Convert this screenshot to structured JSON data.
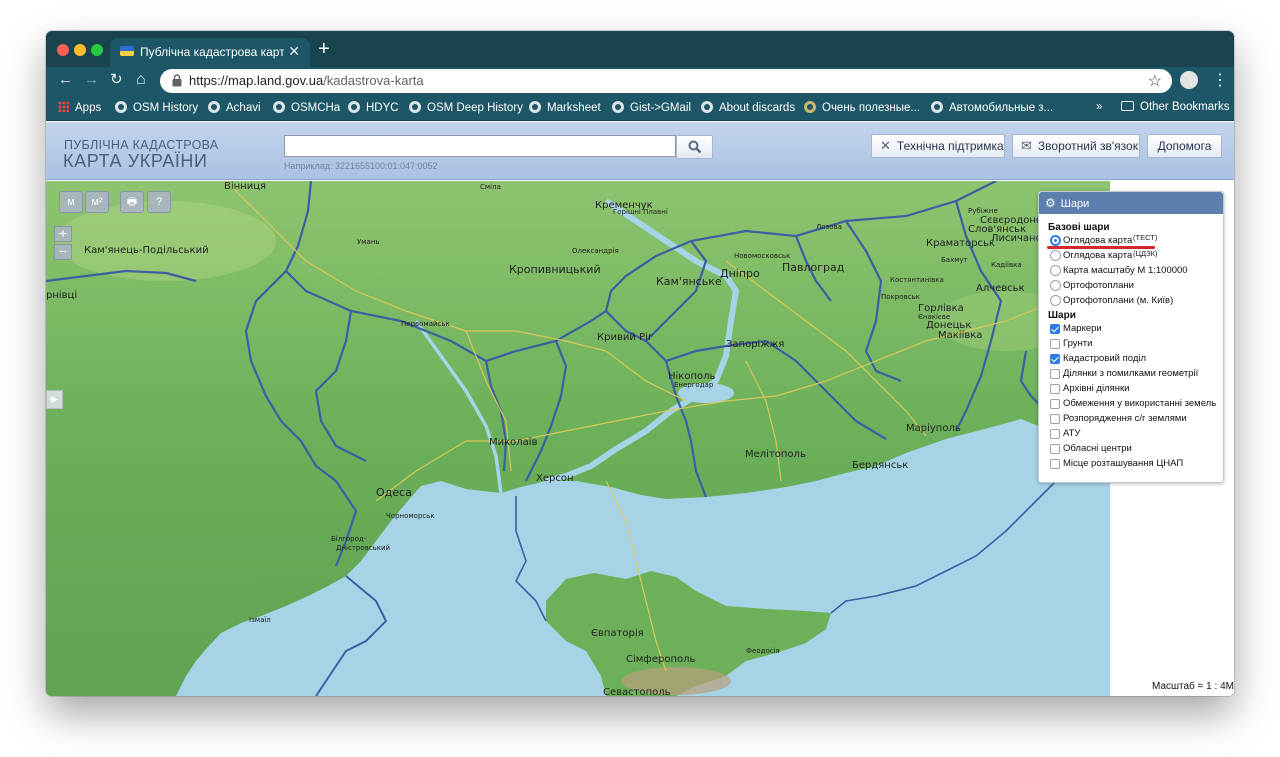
{
  "browser": {
    "tab_title": "Публічна кадастрова карта Ук",
    "tab_close": "✕",
    "new_tab": "+",
    "url_host": "https://map.land.gov.ua",
    "url_path": "/kadastrova-karta",
    "back_icon": "←",
    "forward_icon": "→",
    "reload_icon": "↻",
    "home_icon": "⌂",
    "star_icon": "☆",
    "menu_icon": "⋮"
  },
  "bookmarks": {
    "items": [
      {
        "label": "Apps"
      },
      {
        "label": "OSM History"
      },
      {
        "label": "Achavi"
      },
      {
        "label": "OSMCHa"
      },
      {
        "label": "HDYC"
      },
      {
        "label": "OSM Deep History"
      },
      {
        "label": "Marksheet"
      },
      {
        "label": "Gist->GMail"
      },
      {
        "label": "About discards"
      },
      {
        "label": "Очень полезные..."
      },
      {
        "label": "Автомобильные з..."
      }
    ],
    "overflow": "»",
    "other": "Other Bookmarks"
  },
  "header": {
    "logo_small": "ПУБЛІЧНА КАДАСТРОВА",
    "logo_big": "КАРТА УКРАЇНИ",
    "search_value": "",
    "search_hint": "Наприклад: 3221655100:01:047:0052",
    "support_button": "Технічна підтримка",
    "feedback_button": "Зворотний зв'язок",
    "help_button": "Допомога"
  },
  "map_controls": {
    "measure_length": "м",
    "measure_area": "м²",
    "print_icon": "🖶",
    "identify_icon": "?",
    "zoom_in": "+",
    "zoom_out": "−",
    "side_toggle": "▶"
  },
  "layers_panel": {
    "title": "Шари",
    "base_section": "Базові шари",
    "base_layers": [
      {
        "label": "Оглядова карта",
        "selected": true
      },
      {
        "label": "Оглядова карта",
        "selected": false
      },
      {
        "label": "Карта масштабу М 1:100000",
        "selected": false
      },
      {
        "label": "Ортофотоплани",
        "selected": false
      },
      {
        "label": "Ортофотоплани (м. Київ)",
        "selected": false
      }
    ],
    "sup_test": "(ТЕСТ)",
    "sup_dzk": "(ЦДЗК)",
    "layers_section": "Шари",
    "layers": [
      {
        "label": "Маркери",
        "checked": true
      },
      {
        "label": "Грунти",
        "checked": false
      },
      {
        "label": "Кадастровий поділ",
        "checked": true
      },
      {
        "label": "Ділянки з помилками геометрії",
        "checked": false
      },
      {
        "label": "Архівні ділянки",
        "checked": false
      },
      {
        "label": "Обмеження у використанні земель",
        "checked": false
      },
      {
        "label": "Розпорядження с/г землями",
        "checked": false
      },
      {
        "label": "АТУ",
        "checked": false
      },
      {
        "label": "Обласні центри",
        "checked": false
      },
      {
        "label": "Місце розташування ЦНАП",
        "checked": false
      }
    ]
  },
  "scale": "Масштаб = 1 : 4M",
  "map_labels": {
    "vinnytsia": "Вінниця",
    "kamianets": "Кам'янець-Подільський",
    "chernivtsi": "рнівці",
    "uman": "Умань",
    "smila": "Сміла",
    "kremenchuk": "Кременчук",
    "horishni": "Горішні Плавні",
    "oleksandriia": "Олександрія",
    "kropyvnytskyi": "Кропивницький",
    "novomoskovsk": "Новомосковськ",
    "lozova": "Лозова",
    "kamianske": "Кам'янське",
    "dnipro": "Дніпро",
    "pavlohrad": "Павлоград",
    "sloviansk": "Слов'янськ",
    "rubizhne": "Рубіжне",
    "sievierodonetsk": "Сєвєродонецьк",
    "kramatorsk": "Краматорськ",
    "lysychansk": "Лисичанськ",
    "bakhmut": "Бахмут",
    "kadiivka": "Кадіївка",
    "kostiantynivka": "Костянтинівка",
    "alchevsk": "Алчевськ",
    "pokrovsk": "Покровськ",
    "horlivka": "Горлівка",
    "yenakiieve": "Єнакієве",
    "donetsk": "Донецьк",
    "makiivka": "Макіївка",
    "pervomaisk": "Первомайськ",
    "kryvyi_rih": "Кривий Ріг",
    "zaporizhzhia": "Запоріжжя",
    "nikopol": "Нікополь",
    "enerhodar": "Енергодар",
    "mykolaiv": "Миколаїв",
    "melitopol": "Мелітополь",
    "mariupol": "Маріуполь",
    "berdiansk": "Бердянськ",
    "kherson": "Херсон",
    "odesa": "Одеса",
    "chornomorsk": "Чорноморськ",
    "bilhorod": "Білгород-",
    "dnistrovskyi": "Дністровський",
    "izmail": "Ізмаїл",
    "yevpatoriia": "Євпаторія",
    "simferopol": "Сімферополь",
    "feodosiia": "Феодосія",
    "sevastopol": "Севастополь"
  },
  "colors": {
    "chrome_dark": "#18434f",
    "chrome": "#1d5666",
    "header_blue": "#aac2e4",
    "sea": "#a6d4e6",
    "land_green": "#6fb562",
    "border_blue": "#3b5fa3",
    "selection_red": "#d3282b"
  }
}
